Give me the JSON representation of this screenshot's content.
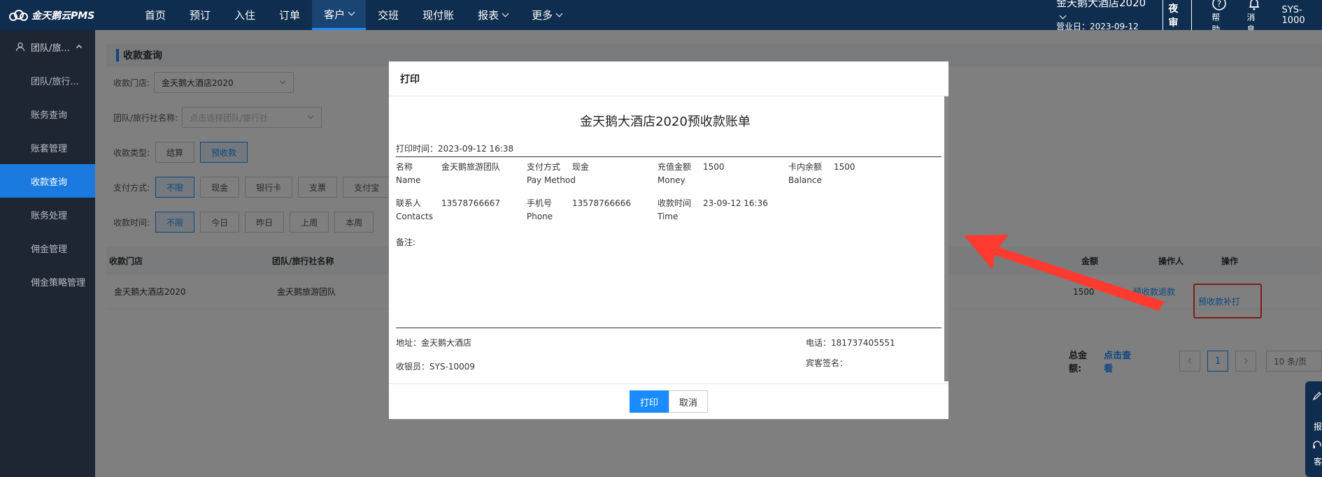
{
  "app": {
    "logo_text": "金天鹅云PMS"
  },
  "nav": {
    "items": [
      {
        "label": "首页"
      },
      {
        "label": "预订"
      },
      {
        "label": "入住"
      },
      {
        "label": "订单"
      },
      {
        "label": "客户"
      },
      {
        "label": "交班"
      },
      {
        "label": "现付账"
      },
      {
        "label": "报表"
      },
      {
        "label": "更多"
      }
    ],
    "hotel_name": "金天鹅大酒店2020",
    "biz_date": "营业日：2023-09-12",
    "night_audit": "夜审",
    "help": "帮助",
    "messages": "消息",
    "user": "SYS-1000"
  },
  "sidebar": {
    "group": "团队/旅...",
    "items": [
      {
        "label": "团队/旅行..."
      },
      {
        "label": "账务查询"
      },
      {
        "label": "账套管理"
      },
      {
        "label": "收款查询"
      },
      {
        "label": "账务处理"
      },
      {
        "label": "佣金管理"
      },
      {
        "label": "佣金策略管理"
      }
    ]
  },
  "page": {
    "title": "收款查询",
    "store_label": "收款门店:",
    "store_value": "金天鹅大酒店2020",
    "agency_label": "团队/旅行社名称:",
    "agency_placeholder": "点击选择团队/旅行社",
    "type_label": "收款类型:",
    "type_options": [
      "结算",
      "预收款"
    ],
    "pay_label": "支付方式:",
    "pay_options": [
      "不限",
      "现金",
      "银行卡",
      "支票",
      "支付宝"
    ],
    "time_label": "收款时间:",
    "time_options": [
      "不限",
      "今日",
      "昨日",
      "上周",
      "本周"
    ],
    "table": {
      "headers": [
        "收款门店",
        "团队/旅行社名称",
        "金额",
        "操作人",
        "操作"
      ],
      "row": {
        "store": "金天鹅大酒店2020",
        "agency": "金天鹅旅游团队",
        "amount": "1500",
        "action_refund": "预收款退款",
        "action_reprint": "预收款补打"
      }
    },
    "total_label": "总金额:",
    "total_link": "点击查看",
    "page_current": "1",
    "page_size": "10 条/页"
  },
  "float_panel": {
    "label1": "报",
    "label2": "客"
  },
  "modal": {
    "title": "打印",
    "doc_title": "金天鹅大酒店2020预收款账单",
    "print_time": "打印时间：2023-09-12 16:38",
    "fields": {
      "name_cn": "名称",
      "name_en": "Name",
      "name_val": "金天鹅旅游团队",
      "paymethod_cn": "支付方式",
      "paymethod_en": "Pay Method",
      "paymethod_val": "现金",
      "money_cn": "充值金额",
      "money_en": "Money",
      "money_val": "1500",
      "balance_cn": "卡内余额",
      "balance_en": "Balance",
      "balance_val": "1500",
      "contacts_cn": "联系人",
      "contacts_en": "Contacts",
      "contacts_val": "13578766667",
      "phone_cn": "手机号",
      "phone_en": "Phone",
      "phone_val": "13578766666",
      "time_cn": "收款时间",
      "time_en": "Time",
      "time_val": "23-09-12 16:36",
      "remark": "备注:"
    },
    "address": "地址：金天鹅大酒店",
    "cashier": "收银员：SYS-10009",
    "tel": "电话：181737405551",
    "guest_sign": "宾客签名：",
    "btn_print": "打印",
    "btn_cancel": "取消"
  },
  "colors": {
    "nav_bg": "#0f2d4e",
    "accent": "#1b8cff",
    "sidebar_bg": "#1e2633",
    "annotation": "#ff3b30"
  }
}
